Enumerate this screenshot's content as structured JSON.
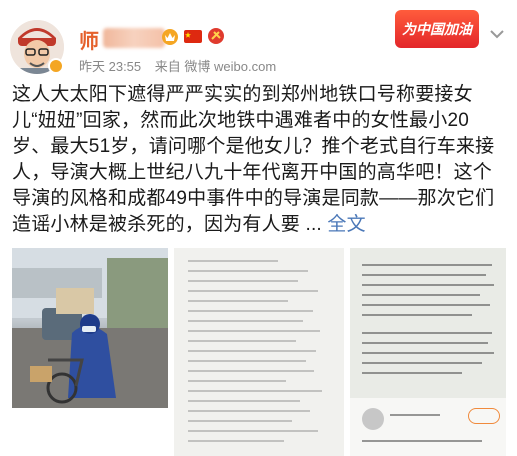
{
  "post": {
    "author_name": "师",
    "time": "昨天 23:55",
    "source": "来自 微博 weibo.com",
    "promo_label": "为中国加油",
    "body": "这人大太阳下遮得严严实实的到郑州地铁口号称要接女儿“妞妞”回家，然而此次地铁中遇难者中的女性最小20岁、最大51岁，请问哪个是他女儿？推个老式自行车来接人，导演大概上世纪八九十年代离开中国的高华吧！这个导演的风格和成都49中事件中的导演是同款——那次它们造谣小林是被杀死的，因为有人要 ... ",
    "more_label": "全文"
  },
  "icons": {
    "avatar": "avatar-photo",
    "verified": "verified-badge-icon",
    "badge1": "crown-badge-icon",
    "badge2": "china-flag-icon",
    "badge3": "party-badge-icon",
    "chevron": "chevron-down-icon"
  },
  "colors": {
    "author": "#e5602b",
    "link": "#4b78b8",
    "promo": "#e3262a"
  }
}
